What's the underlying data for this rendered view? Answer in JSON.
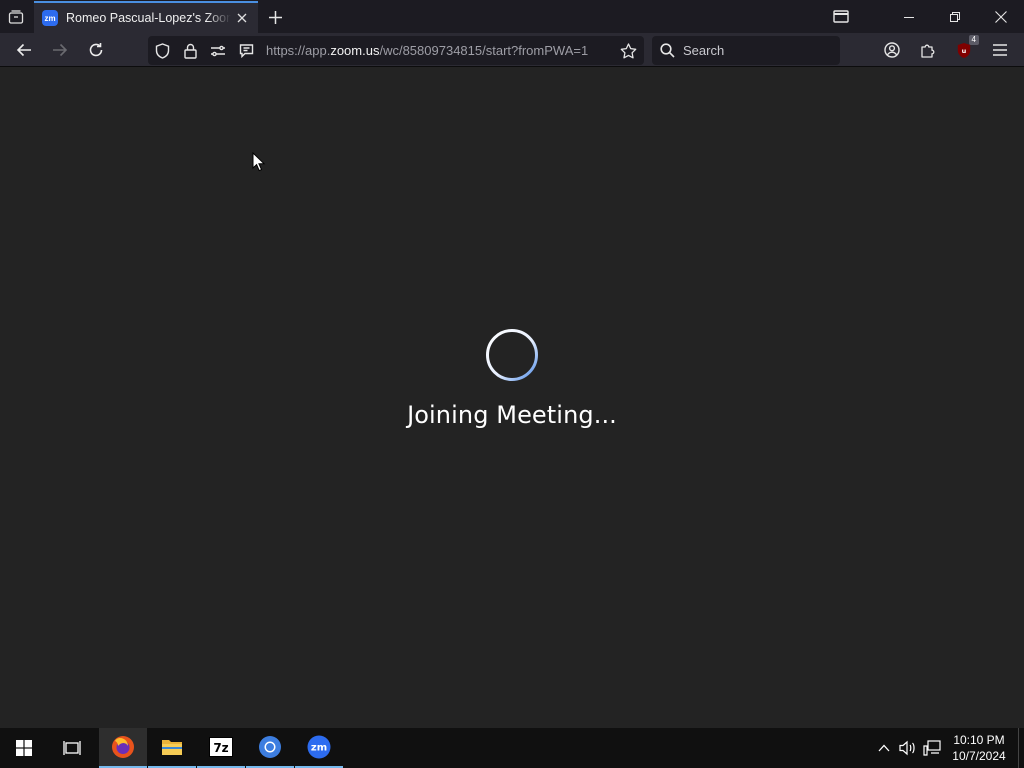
{
  "browser": {
    "tab": {
      "title": "Romeo Pascual-Lopez's Zoom Meeting",
      "favicon_text": "zm"
    },
    "url": {
      "prefix": "https://app.",
      "host": "zoom.us",
      "path": "/wc/85809734815/start?fromPWA=1"
    },
    "search_placeholder": "Search",
    "extension_badge": "4"
  },
  "meeting": {
    "status_text": "Joining Meeting..."
  },
  "taskbar": {
    "zoom_label": "zm",
    "archive_label": "7z",
    "time": "10:10 PM",
    "date": "10/7/2024"
  },
  "colors": {
    "accent": "#76b9ed",
    "zoom_blue": "#2d6cf0",
    "page_bg": "#232323"
  }
}
